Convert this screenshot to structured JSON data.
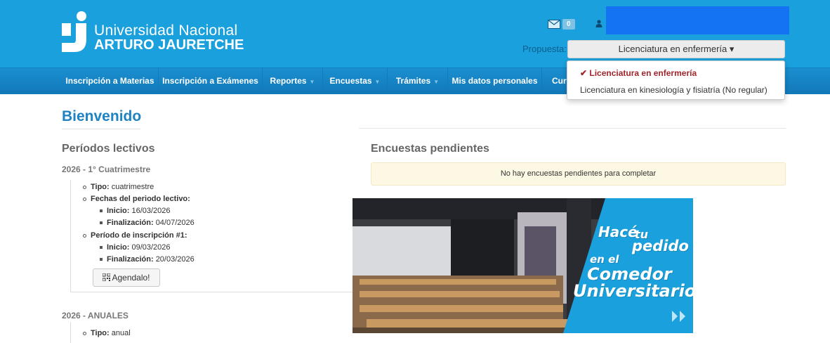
{
  "header": {
    "logo_line1": "Universidad Nacional",
    "logo_line2": "ARTURO JAURETCHE",
    "mail_count": "0",
    "propuesta_label": "Propuesta:",
    "propuesta_selected": "Licenciatura en enfermería ▾"
  },
  "nav": {
    "items": [
      {
        "label": "Inscripción a Materias"
      },
      {
        "label": "Inscripción a Exámenes"
      },
      {
        "label": "Reportes"
      },
      {
        "label": "Encuestas"
      },
      {
        "label": "Trámites"
      },
      {
        "label": "Mis datos personales"
      },
      {
        "label": "Curs"
      }
    ]
  },
  "propuesta_dropdown": {
    "options": [
      {
        "label": "✔ Licenciatura en enfermería",
        "selected": true
      },
      {
        "label": "Licenciatura en kinesiología y fisiatría (No regular)",
        "selected": false
      }
    ]
  },
  "main": {
    "title": "Bienvenido",
    "periodos_title": "Períodos lectivos",
    "periodo1": {
      "title": "2026 - 1° Cuatrimestre",
      "tipo_label": "Tipo:",
      "tipo_value": "cuatrimestre",
      "fechas_label": "Fechas del periodo lectivo:",
      "inicio_label": "Inicio:",
      "inicio_value": "16/03/2026",
      "fin_label": "Finalización:",
      "fin_value": "04/07/2026",
      "insc_label": "Período de inscripción #1:",
      "insc_inicio_label": "Inicio:",
      "insc_inicio_value": "09/03/2026",
      "insc_fin_label": "Finalización:",
      "insc_fin_value": "20/03/2026",
      "agendalo_label": "Agendalo!"
    },
    "periodo2": {
      "title": "2026 - ANUALES",
      "tipo_label": "Tipo:",
      "tipo_value": "anual"
    },
    "encuestas_title": "Encuestas pendientes",
    "encuestas_empty": "No hay encuestas pendientes para completar"
  },
  "banner": {
    "hace": "Hacé",
    "tu": "tu",
    "pedido": "pedido",
    "en_el": "en el",
    "comedor": "Comedor",
    "universitario": "Universitario"
  },
  "colors": {
    "header_bg": "#1aa0dc",
    "nav_bg": "#1278b8",
    "title_blue": "#1e82c3",
    "selected_red": "#a3262d",
    "alert_bg": "#fcf8e3",
    "banner_blue": "#1aa0dc"
  }
}
